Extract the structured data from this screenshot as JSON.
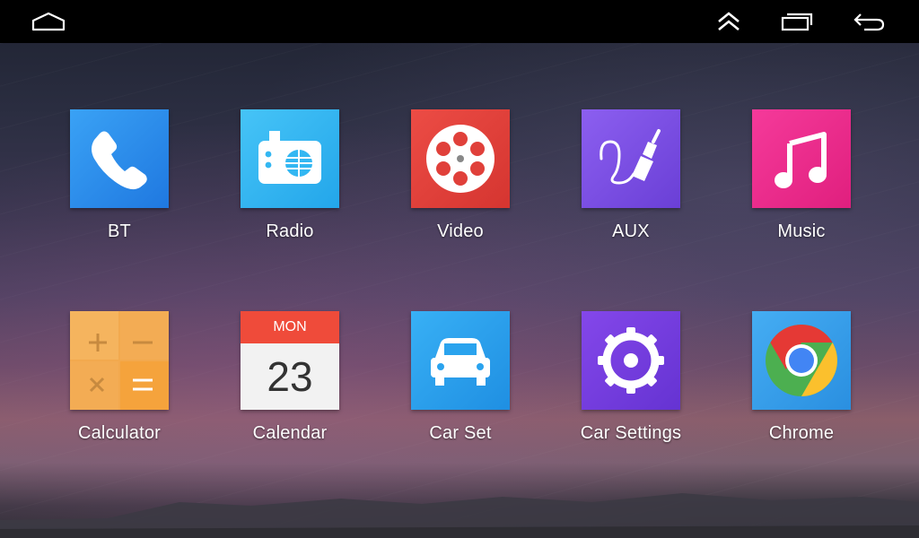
{
  "nav": {
    "home_icon": "home-icon",
    "up_icon": "double-chevron-up-icon",
    "recents_icon": "recent-apps-icon",
    "back_icon": "back-icon"
  },
  "colors": {
    "bt": "#2f8fee",
    "radio": "#33b7f2",
    "video": "#e0403a",
    "aux": "#7a4fe0",
    "music": "#f02a8e",
    "calculator": "#f2a94e",
    "calendar_top": "#ef4b3a",
    "carset": "#2aa3ee",
    "carsettings": "#7a3fe0",
    "chrome": "#3aa0ee"
  },
  "apps": [
    {
      "label": "BT",
      "icon": "phone-icon"
    },
    {
      "label": "Radio",
      "icon": "radio-icon"
    },
    {
      "label": "Video",
      "icon": "film-reel-icon"
    },
    {
      "label": "AUX",
      "icon": "aux-cable-icon"
    },
    {
      "label": "Music",
      "icon": "music-note-icon"
    },
    {
      "label": "Calculator",
      "icon": "calculator-icon"
    },
    {
      "label": "Calendar",
      "icon": "calendar-icon",
      "month_day": "MON",
      "date": "23"
    },
    {
      "label": "Car Set",
      "icon": "car-icon"
    },
    {
      "label": "Car Settings",
      "icon": "gear-icon"
    },
    {
      "label": "Chrome",
      "icon": "chrome-icon"
    }
  ]
}
